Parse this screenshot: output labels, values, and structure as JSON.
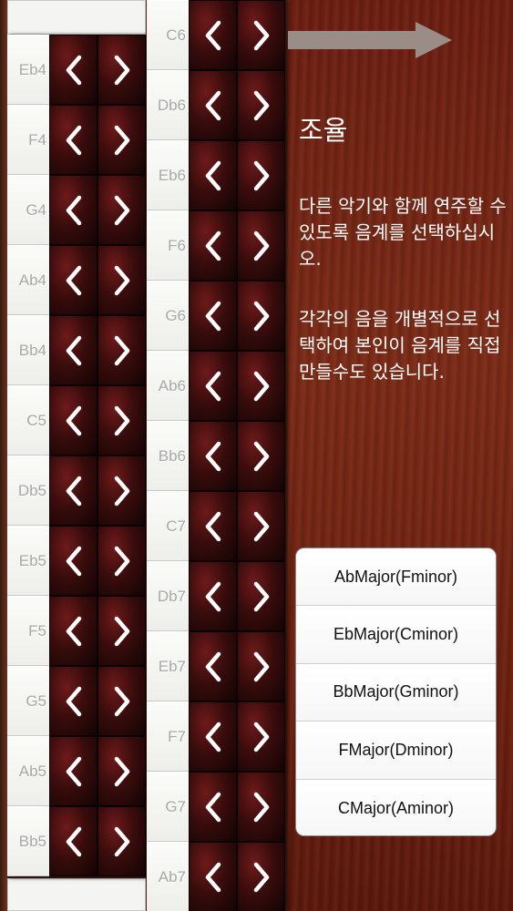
{
  "left_column_notes": [
    "Eb4",
    "F4",
    "G4",
    "Ab4",
    "Bb4",
    "C5",
    "Db5",
    "Eb5",
    "F5",
    "G5",
    "Ab5",
    "Bb5"
  ],
  "right_column_notes": [
    "C6",
    "Db6",
    "Eb6",
    "F6",
    "G6",
    "Ab6",
    "Bb6",
    "C7",
    "Db7",
    "Eb7",
    "F7",
    "G7",
    "Ab7"
  ],
  "icons": {
    "decrease": "chevron-left-icon",
    "increase": "chevron-right-icon",
    "next": "arrow-right-icon"
  },
  "panel": {
    "title": "조율",
    "description_1": "다른 악기와 함께 연주할 수 있도록 음계를 선택하십시오.",
    "description_2": "각각의 음을 개별적으로 선택하여 본인이 음계를 직접 만들수도 있습니다."
  },
  "scales": [
    "AbMajor(Fminor)",
    "EbMajor(Cminor)",
    "BbMajor(Gminor)",
    "FMajor(Dminor)",
    "CMajor(Aminor)"
  ],
  "colors": {
    "wood": "#6a1e10",
    "key_label": "#a8a8a8",
    "button_red": "#6e1a1a"
  }
}
